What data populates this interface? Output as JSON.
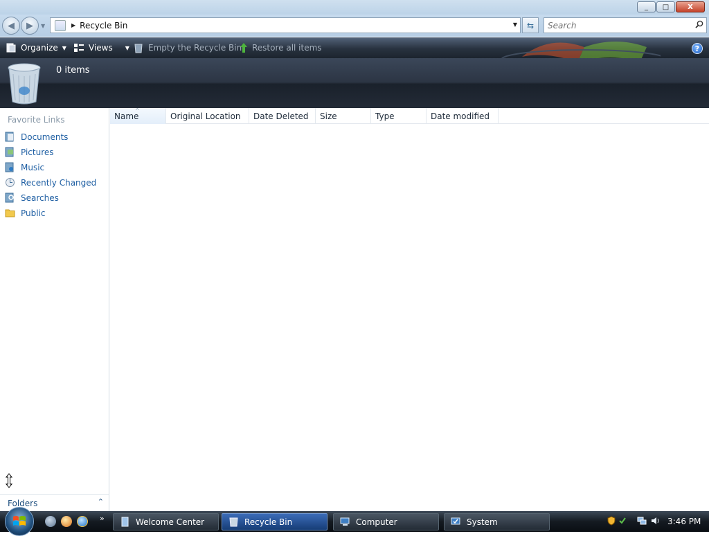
{
  "window": {
    "caption_buttons": {
      "minimize": "_",
      "maximize": "□",
      "close": "X"
    }
  },
  "address_bar": {
    "location": "Recycle Bin",
    "search_placeholder": "Search"
  },
  "toolbar": {
    "organize": "Organize",
    "views": "Views",
    "empty_bin": "Empty the Recycle Bin",
    "restore_all": "Restore all items",
    "help": "?"
  },
  "header": {
    "item_count": "0 items"
  },
  "nav_pane": {
    "section_title": "Favorite Links",
    "links": [
      {
        "label": "Documents",
        "icon": "documents-icon"
      },
      {
        "label": "Pictures",
        "icon": "pictures-icon"
      },
      {
        "label": "Music",
        "icon": "music-icon"
      },
      {
        "label": "Recently Changed",
        "icon": "recently-changed-icon"
      },
      {
        "label": "Searches",
        "icon": "searches-icon"
      },
      {
        "label": "Public",
        "icon": "public-folder-icon"
      }
    ],
    "folders_label": "Folders"
  },
  "columns": [
    "Name",
    "Original Location",
    "Date Deleted",
    "Size",
    "Type",
    "Date modified"
  ],
  "taskbar": {
    "quick_launch_more": "»",
    "tasks": [
      "Welcome Center",
      "Recycle Bin",
      "Computer",
      "System"
    ],
    "active_task": "Recycle Bin",
    "clock": "3:46 PM"
  },
  "colors": {
    "link_blue": "#1f5fa3",
    "toolbar_dark": "#28323f",
    "header_band": "#2c3544"
  }
}
